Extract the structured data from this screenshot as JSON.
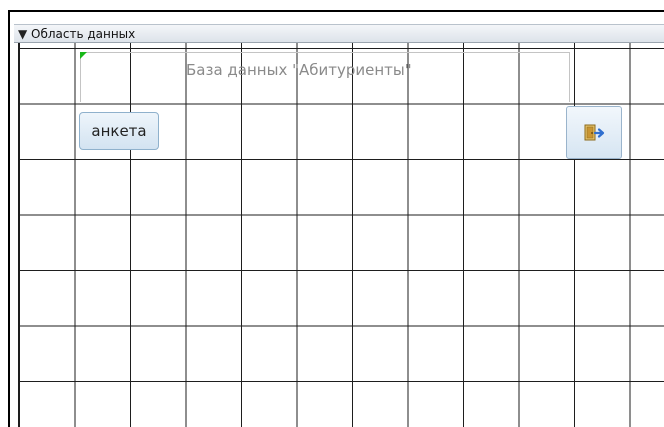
{
  "section": {
    "icon": "collapse-arrow-icon",
    "label": "Область данных"
  },
  "form": {
    "title": "База данных \"Абитуриенты\"",
    "anketa_button": "анкета",
    "exit_button_icon": "exit-door-icon"
  },
  "colors": {
    "grid_line": "#1e1e1e",
    "button_fill": "#d3e3f1",
    "button_border": "#8fb1cc",
    "title_text": "#8a8a8a",
    "selection_marker": "#18b818"
  }
}
